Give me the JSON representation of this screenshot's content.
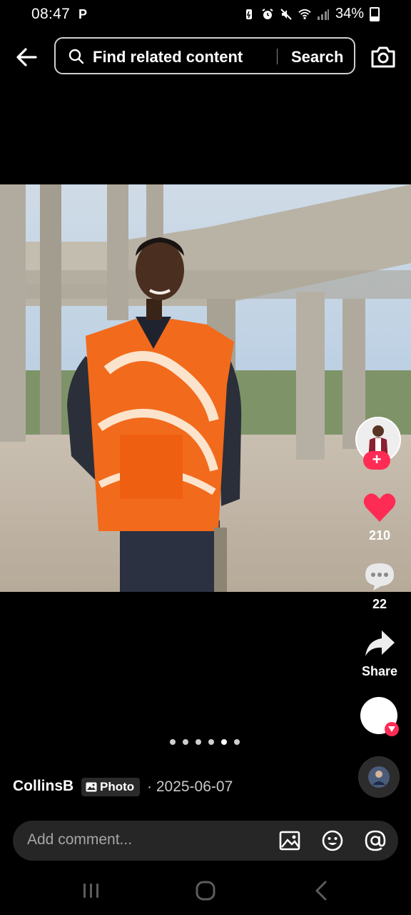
{
  "status_bar": {
    "time": "08:47",
    "battery": "34%"
  },
  "search": {
    "placeholder": "Find related content",
    "button": "Search"
  },
  "post": {
    "author": "CollinsB",
    "badge": "Photo",
    "separator": "·",
    "date": "2025-06-07",
    "slides_total": 6
  },
  "actions": {
    "likes": "210",
    "comments": "22",
    "share_label": "Share"
  },
  "comment_input": {
    "placeholder": "Add comment..."
  },
  "colors": {
    "accent": "#fe2c55",
    "background": "#000000",
    "shirt": "#f26a1b"
  }
}
